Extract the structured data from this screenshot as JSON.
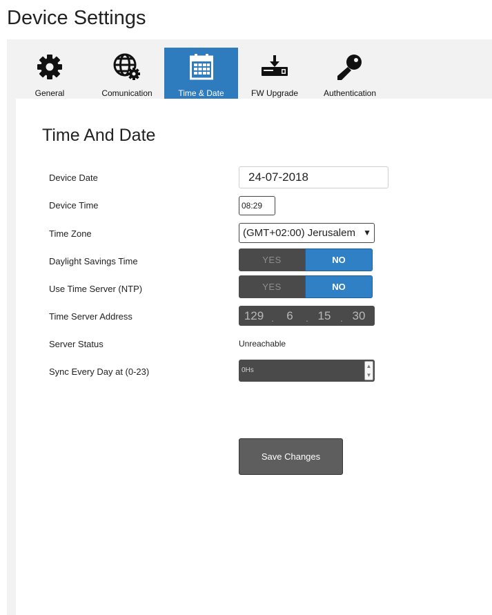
{
  "page": {
    "title": "Device Settings"
  },
  "tabs": [
    {
      "label": "General",
      "icon": "gear-icon",
      "active": false
    },
    {
      "label": "Comunication",
      "icon": "globe-gear-icon",
      "active": false
    },
    {
      "label": "Time & Date",
      "icon": "calendar-icon",
      "active": true
    },
    {
      "label": "FW Upgrade",
      "icon": "download-device-icon",
      "active": false
    },
    {
      "label": "Authentication",
      "icon": "key-icon",
      "active": false
    }
  ],
  "section": {
    "title": "Time And Date"
  },
  "fields": {
    "device_date": {
      "label": "Device Date",
      "value": "24-07-2018"
    },
    "device_time": {
      "label": "Device Time",
      "value": "08:29"
    },
    "time_zone": {
      "label": "Time Zone",
      "value": "(GMT+02:00) Jerusalem",
      "arrow": "▼"
    },
    "dst": {
      "label": "Daylight Savings Time",
      "yes": "YES",
      "no": "NO",
      "selected": "NO"
    },
    "ntp": {
      "label": "Use Time Server (NTP)",
      "yes": "YES",
      "no": "NO",
      "selected": "NO"
    },
    "server_address": {
      "label": "Time Server Address",
      "octets": [
        "129",
        "6",
        "15",
        "30"
      ]
    },
    "server_status": {
      "label": "Server Status",
      "value": "Unreachable"
    },
    "sync_hour": {
      "label": "Sync Every Day at (0-23)",
      "value": "0Hs"
    }
  },
  "actions": {
    "save_label": "Save Changes"
  },
  "colors": {
    "accent": "#2e7bbd",
    "toggle_off": "#4a4a4a",
    "button": "#5e5e5e"
  }
}
